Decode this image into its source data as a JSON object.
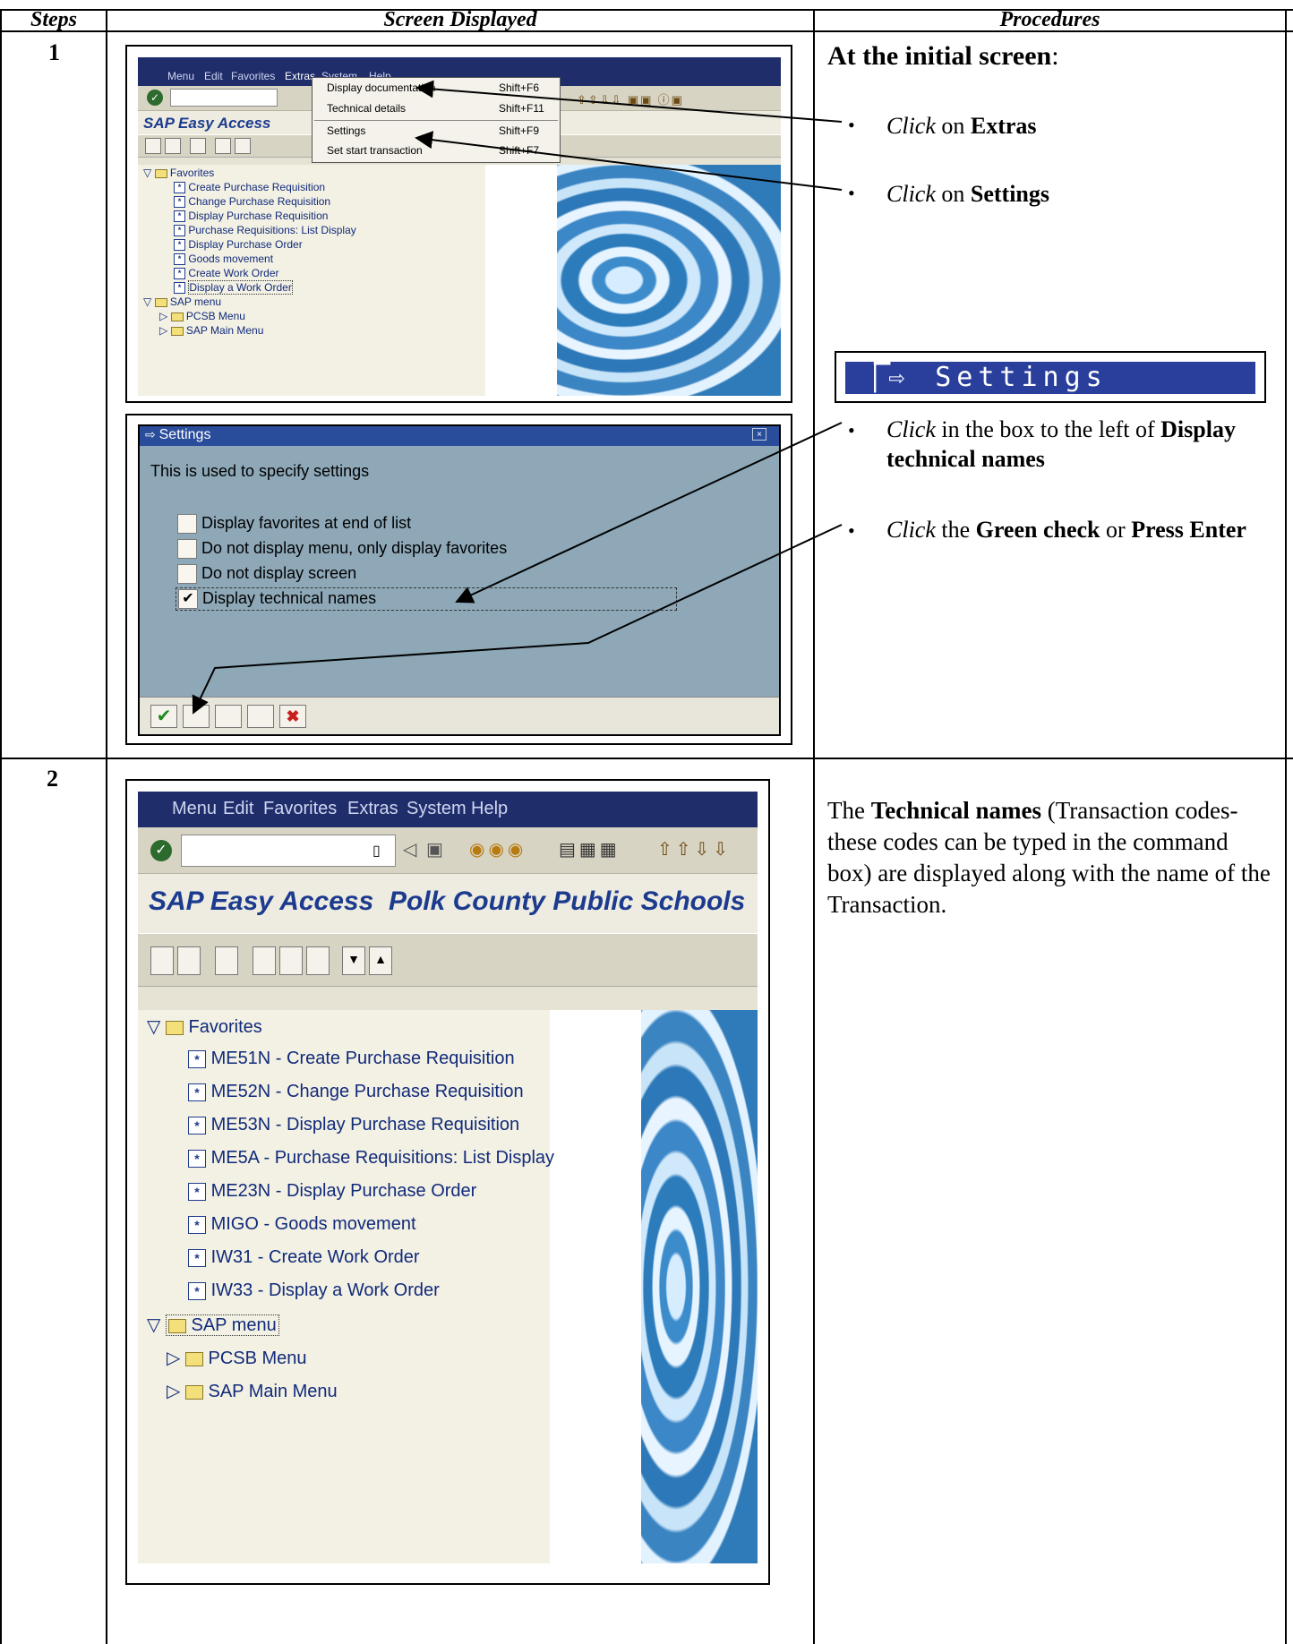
{
  "table": {
    "headers": {
      "steps": "Steps",
      "screen": "Screen Displayed",
      "procedures": "Procedures"
    },
    "step1_number": "1",
    "step2_number": "2"
  },
  "step1": {
    "sap_window": {
      "menu": [
        "Menu",
        "Edit",
        "Favorites",
        "Extras",
        "System",
        "Help"
      ],
      "title": "SAP Easy Access",
      "dropdown": [
        {
          "label": "Display documentation",
          "shortcut": "Shift+F6"
        },
        {
          "label": "Technical details",
          "shortcut": "Shift+F11"
        },
        {
          "label": "Settings",
          "shortcut": "Shift+F9"
        },
        {
          "label": "Set start transaction",
          "shortcut": "Shift+F7"
        }
      ],
      "favorites_label": "Favorites",
      "favorites": [
        "Create Purchase Requisition",
        "Change Purchase Requisition",
        "Display Purchase Requisition",
        "Purchase Requisitions: List Display",
        "Display Purchase Order",
        "Goods movement",
        "Create Work Order",
        "Display a Work Order"
      ],
      "sap_menu_label": "SAP menu",
      "sap_menu_items": [
        "PCSB Menu",
        "SAP Main Menu"
      ]
    },
    "settings_dialog": {
      "title": "Settings",
      "description": "This is used to specify settings",
      "options": [
        {
          "label": "Display favorites at end of list",
          "checked": false
        },
        {
          "label": "Do not display menu, only display favorites",
          "checked": false
        },
        {
          "label": "Do not display screen",
          "checked": false
        },
        {
          "label": "Display technical names",
          "checked": true
        }
      ]
    },
    "procedures": {
      "heading": "At the initial screen",
      "heading_colon": ":",
      "b1_click": "Click",
      "b1_on": " on ",
      "b1_target": "Extras",
      "b2_click": "Click",
      "b2_on": " on ",
      "b2_target": "Settings",
      "settings_badge": "Settings",
      "b3_click": "Click",
      "b3_text": " in the box to the left of ",
      "b3_target": "Display technical names",
      "b4_click": "Click",
      "b4_the": " the ",
      "b4_green": "Green check",
      "b4_or": " or ",
      "b4_press": "Press Enter"
    }
  },
  "step2": {
    "sap_window": {
      "menu": [
        "Menu",
        "Edit",
        "Favorites",
        "Extras",
        "System",
        "Help"
      ],
      "title": "SAP Easy Access  Polk County Public Schools",
      "favorites_label": "Favorites",
      "favorites": [
        "ME51N - Create Purchase Requisition",
        "ME52N - Change Purchase Requisition",
        "ME53N - Display Purchase Requisition",
        "ME5A - Purchase Requisitions: List Display",
        "ME23N - Display Purchase Order",
        "MIGO - Goods movement",
        "IW31 - Create Work Order",
        "IW33 - Display a Work Order"
      ],
      "sap_menu_label": "SAP menu",
      "sap_menu_items": [
        "PCSB Menu",
        "SAP Main Menu"
      ]
    },
    "procedures": {
      "p1": "The ",
      "p_bold": "Technical names",
      "p2": " (Transaction codes- these codes can be typed in the command box) are displayed along with the name of the Transaction."
    }
  }
}
